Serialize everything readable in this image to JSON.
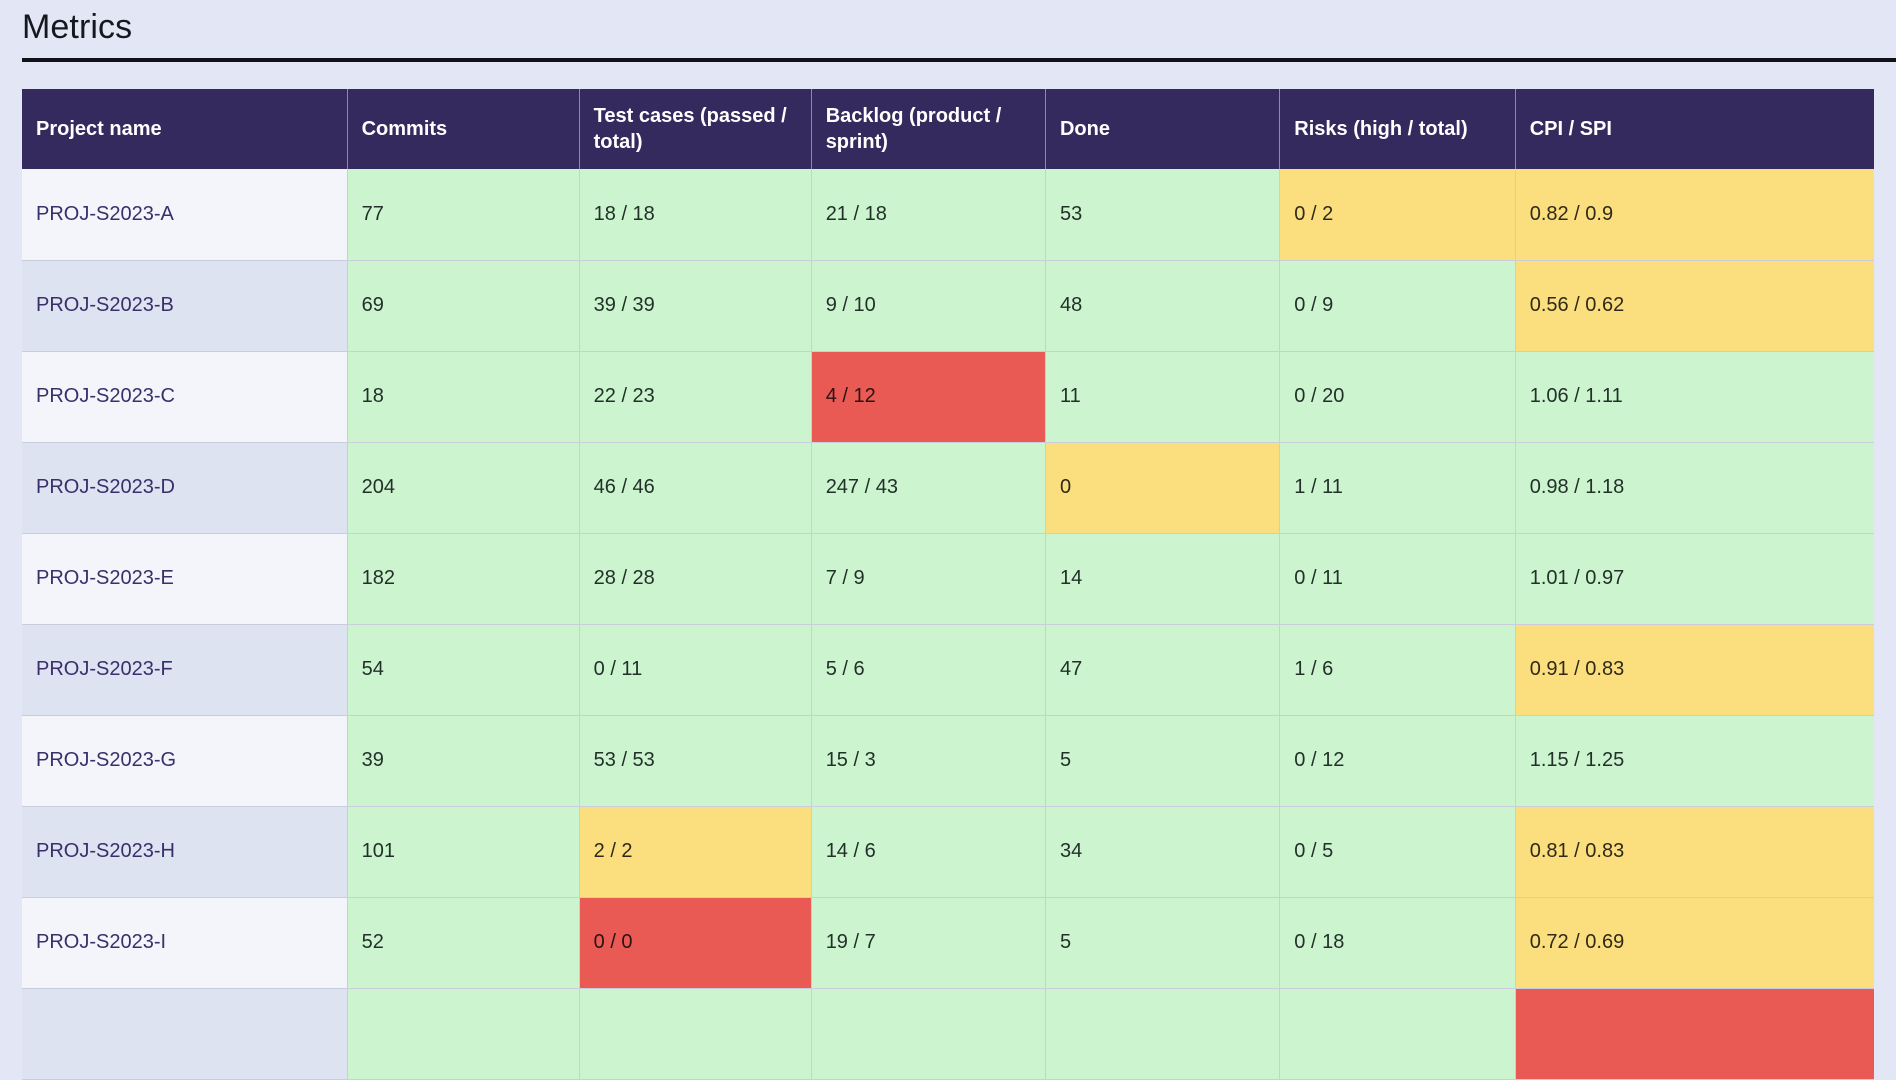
{
  "page": {
    "title": "Metrics",
    "background_color": "#e3e7f5",
    "header_bg_color": "#342a5e",
    "ok_color": "#ccf5cf",
    "warn_color": "#fbdf7e",
    "bad_color": "#ea5a54",
    "stripe_color": "#dde3f1"
  },
  "table": {
    "columns": [
      "Project name",
      "Commits",
      "Test cases (passed / total)",
      "Backlog (product / sprint)",
      "Done",
      "Risks (high / total)",
      "CPI / SPI"
    ],
    "rows": [
      {
        "project": "PROJ-S2023-A",
        "commits": "77",
        "commits_state": "ok",
        "test_cases": "18 / 18",
        "test_cases_state": "ok",
        "backlog": "21 / 18",
        "backlog_state": "ok",
        "done": "53",
        "done_state": "ok",
        "risks": "0 / 2",
        "risks_state": "warn",
        "cpi_spi": "0.82 / 0.9",
        "cpi_spi_state": "warn"
      },
      {
        "project": "PROJ-S2023-B",
        "commits": "69",
        "commits_state": "ok",
        "test_cases": "39 / 39",
        "test_cases_state": "ok",
        "backlog": "9 / 10",
        "backlog_state": "ok",
        "done": "48",
        "done_state": "ok",
        "risks": "0 / 9",
        "risks_state": "ok",
        "cpi_spi": "0.56 / 0.62",
        "cpi_spi_state": "warn"
      },
      {
        "project": "PROJ-S2023-C",
        "commits": "18",
        "commits_state": "ok",
        "test_cases": "22 / 23",
        "test_cases_state": "ok",
        "backlog": "4 / 12",
        "backlog_state": "bad",
        "done": "11",
        "done_state": "ok",
        "risks": "0 / 20",
        "risks_state": "ok",
        "cpi_spi": "1.06 / 1.11",
        "cpi_spi_state": "ok"
      },
      {
        "project": "PROJ-S2023-D",
        "commits": "204",
        "commits_state": "ok",
        "test_cases": "46 / 46",
        "test_cases_state": "ok",
        "backlog": "247 / 43",
        "backlog_state": "ok",
        "done": "0",
        "done_state": "warn",
        "risks": "1 / 11",
        "risks_state": "ok",
        "cpi_spi": "0.98 / 1.18",
        "cpi_spi_state": "ok"
      },
      {
        "project": "PROJ-S2023-E",
        "commits": "182",
        "commits_state": "ok",
        "test_cases": "28 / 28",
        "test_cases_state": "ok",
        "backlog": "7 / 9",
        "backlog_state": "ok",
        "done": "14",
        "done_state": "ok",
        "risks": "0 / 11",
        "risks_state": "ok",
        "cpi_spi": "1.01 / 0.97",
        "cpi_spi_state": "ok"
      },
      {
        "project": "PROJ-S2023-F",
        "commits": "54",
        "commits_state": "ok",
        "test_cases": "0 / 11",
        "test_cases_state": "ok",
        "backlog": "5 / 6",
        "backlog_state": "ok",
        "done": "47",
        "done_state": "ok",
        "risks": "1 / 6",
        "risks_state": "ok",
        "cpi_spi": "0.91 / 0.83",
        "cpi_spi_state": "warn"
      },
      {
        "project": "PROJ-S2023-G",
        "commits": "39",
        "commits_state": "ok",
        "test_cases": "53 / 53",
        "test_cases_state": "ok",
        "backlog": "15 / 3",
        "backlog_state": "ok",
        "done": "5",
        "done_state": "ok",
        "risks": "0 / 12",
        "risks_state": "ok",
        "cpi_spi": "1.15 / 1.25",
        "cpi_spi_state": "ok"
      },
      {
        "project": "PROJ-S2023-H",
        "commits": "101",
        "commits_state": "ok",
        "test_cases": "2 / 2",
        "test_cases_state": "warn",
        "backlog": "14 / 6",
        "backlog_state": "ok",
        "done": "34",
        "done_state": "ok",
        "risks": "0 / 5",
        "risks_state": "ok",
        "cpi_spi": "0.81 / 0.83",
        "cpi_spi_state": "warn"
      },
      {
        "project": "PROJ-S2023-I",
        "commits": "52",
        "commits_state": "ok",
        "test_cases": "0 / 0",
        "test_cases_state": "bad",
        "backlog": "19 / 7",
        "backlog_state": "ok",
        "done": "5",
        "done_state": "ok",
        "risks": "0 / 18",
        "risks_state": "ok",
        "cpi_spi": "0.72 / 0.69",
        "cpi_spi_state": "warn"
      },
      {
        "project": "",
        "commits": "",
        "commits_state": "ok",
        "test_cases": "",
        "test_cases_state": "ok",
        "backlog": "",
        "backlog_state": "ok",
        "done": "",
        "done_state": "ok",
        "risks": "",
        "risks_state": "ok",
        "cpi_spi": "",
        "cpi_spi_state": "bad"
      }
    ]
  }
}
